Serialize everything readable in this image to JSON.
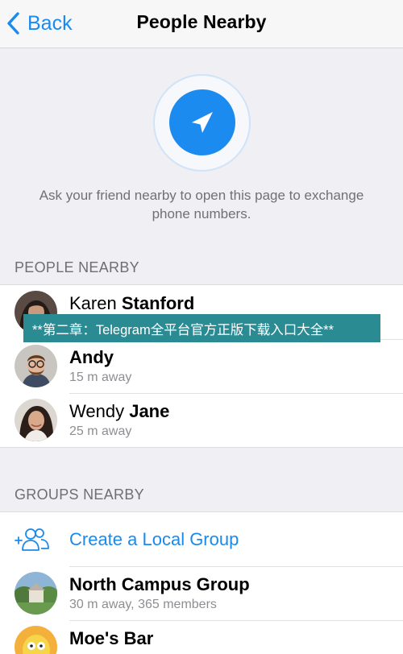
{
  "navbar": {
    "back_label": "Back",
    "title": "People Nearby"
  },
  "hero": {
    "hint": "Ask your friend nearby to open this page to exchange phone numbers.",
    "accent": "#1c8bef"
  },
  "people_section": {
    "header": "PEOPLE NEARBY",
    "people": [
      {
        "first": "Karen",
        "last": "Stanford",
        "distance": ""
      },
      {
        "first": "",
        "last": "Andy",
        "distance": "15 m away"
      },
      {
        "first": "Wendy",
        "last": "Jane",
        "distance": "25 m away"
      }
    ]
  },
  "groups_section": {
    "header": "GROUPS NEARBY",
    "create_label": "Create a Local Group",
    "groups": [
      {
        "name": "North Campus Group",
        "info": "30 m away, 365 members"
      },
      {
        "name": "Moe's Bar",
        "info": ""
      }
    ]
  },
  "banner": {
    "text": "**第二章：Telegram全平台官方正版下载入口大全**",
    "color": "#2a8b93"
  }
}
